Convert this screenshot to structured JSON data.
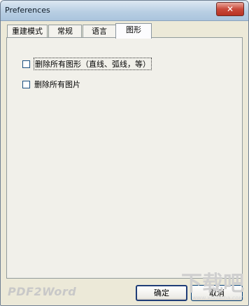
{
  "window": {
    "title": "Preferences",
    "close_symbol": "✕"
  },
  "tabs": [
    {
      "label": "重建模式"
    },
    {
      "label": "常规"
    },
    {
      "label": "语言"
    },
    {
      "label": "图形",
      "active": true
    }
  ],
  "options": [
    {
      "label": "删除所有图形（直线、弧线，等）",
      "checked": false,
      "focused": true
    },
    {
      "label": "删除所有图片",
      "checked": false,
      "focused": false
    }
  ],
  "footer": {
    "brand": "PDF2Word",
    "ok_label": "确定",
    "cancel_label": "取消"
  },
  "watermark": {
    "text": "下载吧",
    "site": "www.xiazaiba.com"
  }
}
